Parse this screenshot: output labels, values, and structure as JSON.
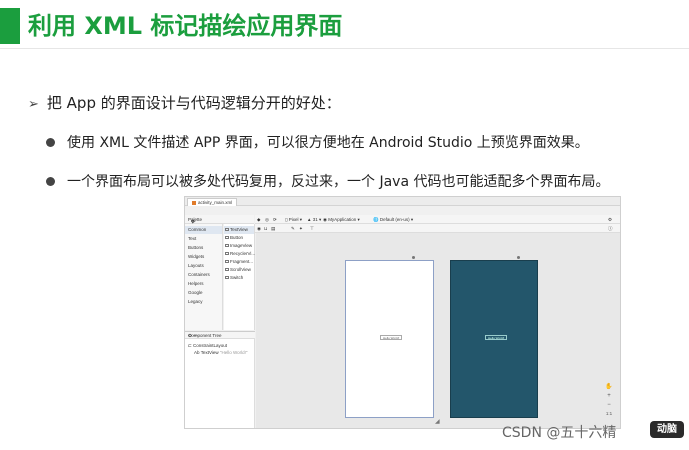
{
  "slide": {
    "title": "利用 XML 标记描绘应用界面",
    "accent_color": "#1b9e3e",
    "bullets": {
      "main": "把 App 的界面设计与代码逻辑分开的好处：",
      "sub1": "使用 XML 文件描述 APP 界面，可以很方便地在 Android Studio 上预览界面效果。",
      "sub2": "一个界面布局可以被多处代码复用，反过来，一个 Java 代码也可能适配多个界面布局。"
    },
    "arrow_glyph": "➢"
  },
  "ide": {
    "file_tab": "activity_main.xml",
    "palette_label": "Palette",
    "toolbar": {
      "device": "Pixel",
      "api": "31",
      "theme": "MyApplication",
      "locale": "Default (en-us)"
    },
    "categories": [
      "Common",
      "Text",
      "Buttons",
      "Widgets",
      "Layouts",
      "Containers",
      "Helpers",
      "Google",
      "Legacy"
    ],
    "widgets": [
      "TextView",
      "Button",
      "ImageView",
      "RecyclerVi...",
      "Fragment...",
      "ScrollView",
      "Switch"
    ],
    "component_tree_label": "Component Tree",
    "tree": {
      "root": "ConstraintLayout",
      "child": "TextView",
      "child_text": "\"Hello World!\""
    },
    "preview_text": "Hello World!",
    "dark_preview_color": "#23566b",
    "zoom_controls": [
      "+",
      "−",
      "1:1"
    ]
  },
  "watermark": {
    "text": "CSDN @五十六精",
    "logo_text": "动脑"
  }
}
